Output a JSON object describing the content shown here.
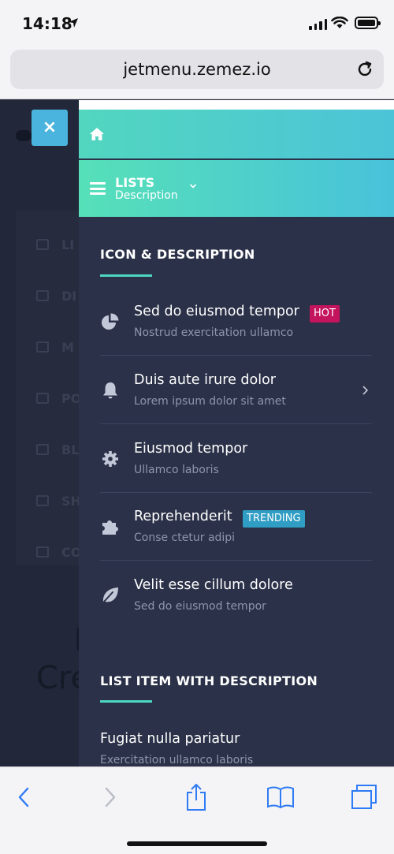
{
  "status_bar": {
    "time": "14:18"
  },
  "browser": {
    "url": "jetmenu.zemez.io"
  },
  "background_page": {
    "rows": [
      "LI",
      "DI",
      "M",
      "PO",
      "BL",
      "SH",
      "CO"
    ],
    "heading_line1": "I",
    "heading_line2": "Cre"
  },
  "menu": {
    "lists_label": "LISTS",
    "lists_description": "Description",
    "section1_title": "ICON & DESCRIPTION",
    "items": [
      {
        "title": "Sed do eiusmod tempor",
        "subtitle": "Nostrud exercitation ullamco",
        "badge": "HOT",
        "icon": "pie-chart-icon"
      },
      {
        "title": "Duis aute irure dolor",
        "subtitle": "Lorem ipsum dolor sit amet",
        "icon": "bell-icon"
      },
      {
        "title": "Eiusmod tempor",
        "subtitle": "Ullamco laboris",
        "icon": "gear-icon"
      },
      {
        "title": "Reprehenderit",
        "subtitle": "Conse ctetur adipi",
        "badge": "TRENDING",
        "icon": "puzzle-icon"
      },
      {
        "title": "Velit esse cillum dolore",
        "subtitle": "Sed do eiusmod tempor",
        "icon": "leaf-icon"
      }
    ],
    "section2_title": "LIST ITEM WITH DESCRIPTION",
    "plain_item": {
      "title": "Fugiat nulla pariatur",
      "subtitle": "Exercitation ullamco laboris"
    }
  },
  "colors": {
    "accent_teal": "#4ed8c4",
    "menu_bg": "#2b3148",
    "hot_badge": "#c4145e",
    "trending_badge": "#2f9dc4",
    "close_button": "#4bb4de",
    "ios_blue": "#2f7bf5"
  }
}
